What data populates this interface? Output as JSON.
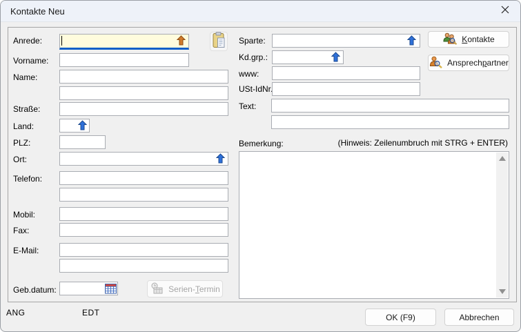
{
  "titlebar": {
    "title": "Kontakte Neu"
  },
  "fields": {
    "anrede": {
      "label": "Anrede:",
      "value": ""
    },
    "vorname": {
      "label": "Vorname:",
      "value": ""
    },
    "name": {
      "label": "Name:",
      "value": "",
      "value2": ""
    },
    "strasse": {
      "label": "Straße:",
      "value": ""
    },
    "land": {
      "label": "Land:",
      "value": ""
    },
    "plz": {
      "label": "PLZ:",
      "value": ""
    },
    "ort": {
      "label": "Ort:",
      "value": ""
    },
    "telefon": {
      "label": "Telefon:",
      "value": "",
      "value2": ""
    },
    "mobil": {
      "label": "Mobil:",
      "value": ""
    },
    "fax": {
      "label": "Fax:",
      "value": ""
    },
    "email": {
      "label": "E-Mail:",
      "value": "",
      "value2": ""
    },
    "gebdatum": {
      "label": "Geb.datum:",
      "value": ""
    },
    "sparte": {
      "label": "Sparte:",
      "value": ""
    },
    "kdgrp": {
      "label": "Kd.grp.:",
      "value": ""
    },
    "www": {
      "label": "www:",
      "value": ""
    },
    "ustidnr": {
      "label": "USt-IdNr.:",
      "value": ""
    },
    "text": {
      "label": "Text:",
      "value": "",
      "value2": ""
    },
    "bemerkung": {
      "label": "Bemerkung:",
      "hint": "(Hinweis: Zeilenumbruch mit STRG + ENTER)",
      "value": ""
    }
  },
  "buttons": {
    "kontakte": {
      "pre": "",
      "accel": "K",
      "post": "ontakte"
    },
    "ansprechpartner": {
      "pre": "Ansprech",
      "accel": "p",
      "post": "artner"
    },
    "serien_termin": {
      "pre": "Serien-",
      "accel": "T",
      "post": "ermin"
    },
    "ok": {
      "label": "OK (F9)"
    },
    "abbrechen": {
      "label": "Abbrechen"
    }
  },
  "statusbar": {
    "ang": "ANG",
    "edt": "EDT"
  },
  "icons": {
    "close": "✕",
    "lookup_arrow_blue": "⇧",
    "lookup_arrow_orange": "⇧",
    "clipboard_paste": "📋",
    "calendar": "📅",
    "kontakte_people_search": "👥🔍",
    "ansprechpartner_person_search": "👤🔍",
    "serien_termin_clock_calendar": "🕘📅",
    "scroll_up": "▲",
    "scroll_down": "▼"
  },
  "colors": {
    "titlebar_bg": "#eef2f9",
    "dialog_bg": "#f0f0f0",
    "focus_field_bg": "#fffcdd",
    "focus_underline": "#0b5fc8",
    "lookup_arrow_blue": "#2e70d9",
    "lookup_arrow_orange": "#cf7a2a",
    "button_bg": "#fdfdfd",
    "disabled_text": "#a6a6a6"
  }
}
